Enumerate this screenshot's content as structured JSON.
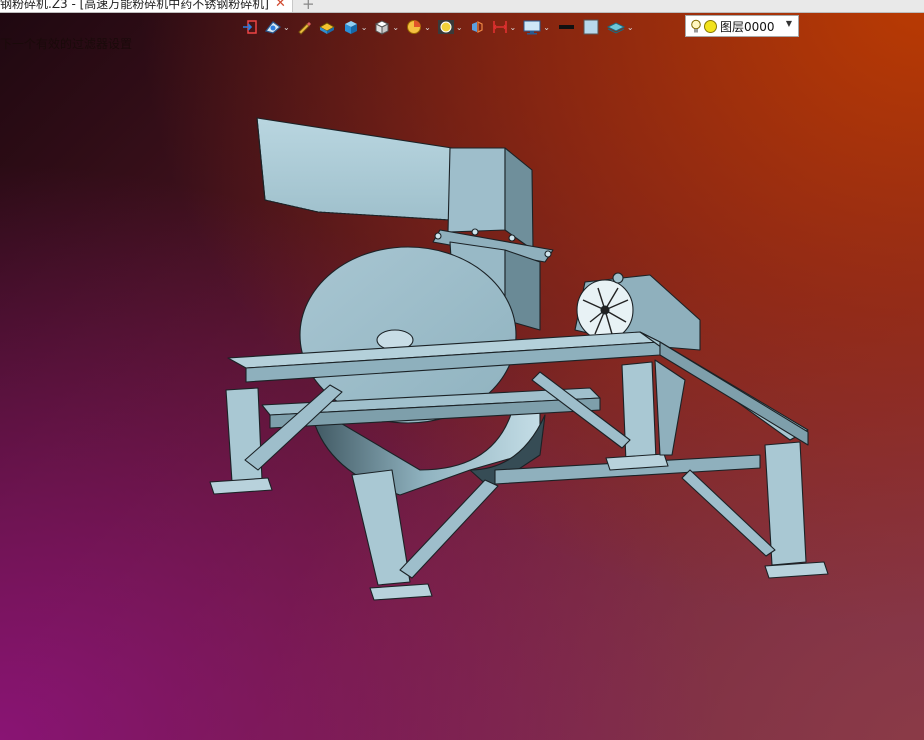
{
  "window": {
    "tab_title": "钢粉碎机.Z3 - [高速万能粉碎机中药不锈钢粉碎机]",
    "tab_close": "✕",
    "new_tab": "+"
  },
  "toolbar": {
    "buttons": [
      {
        "name": "exit-icon"
      },
      {
        "name": "view-orient-icon",
        "caret": true
      },
      {
        "name": "pencil-icon"
      },
      {
        "name": "shaded-icon"
      },
      {
        "name": "cube-blue-icon",
        "caret": true
      },
      {
        "name": "cube-white-icon",
        "caret": true
      },
      {
        "name": "pie-icon",
        "caret": true
      },
      {
        "name": "render-icon",
        "caret": true
      },
      {
        "name": "snap-icon"
      },
      {
        "name": "dimension-icon",
        "caret": true
      },
      {
        "name": "display-icon",
        "caret": true
      },
      {
        "name": "line-color-icon"
      },
      {
        "name": "face-color-icon"
      },
      {
        "name": "layer-plane-icon",
        "caret": true
      }
    ],
    "layer_label": "图层0000",
    "layer_dot_color": "#f2e21c"
  },
  "status": {
    "message": "下一个有效的过滤器设置"
  },
  "colors": {
    "part": "#aacbd6",
    "part_dark": "#7fa4b0",
    "edge": "#1b2226"
  }
}
